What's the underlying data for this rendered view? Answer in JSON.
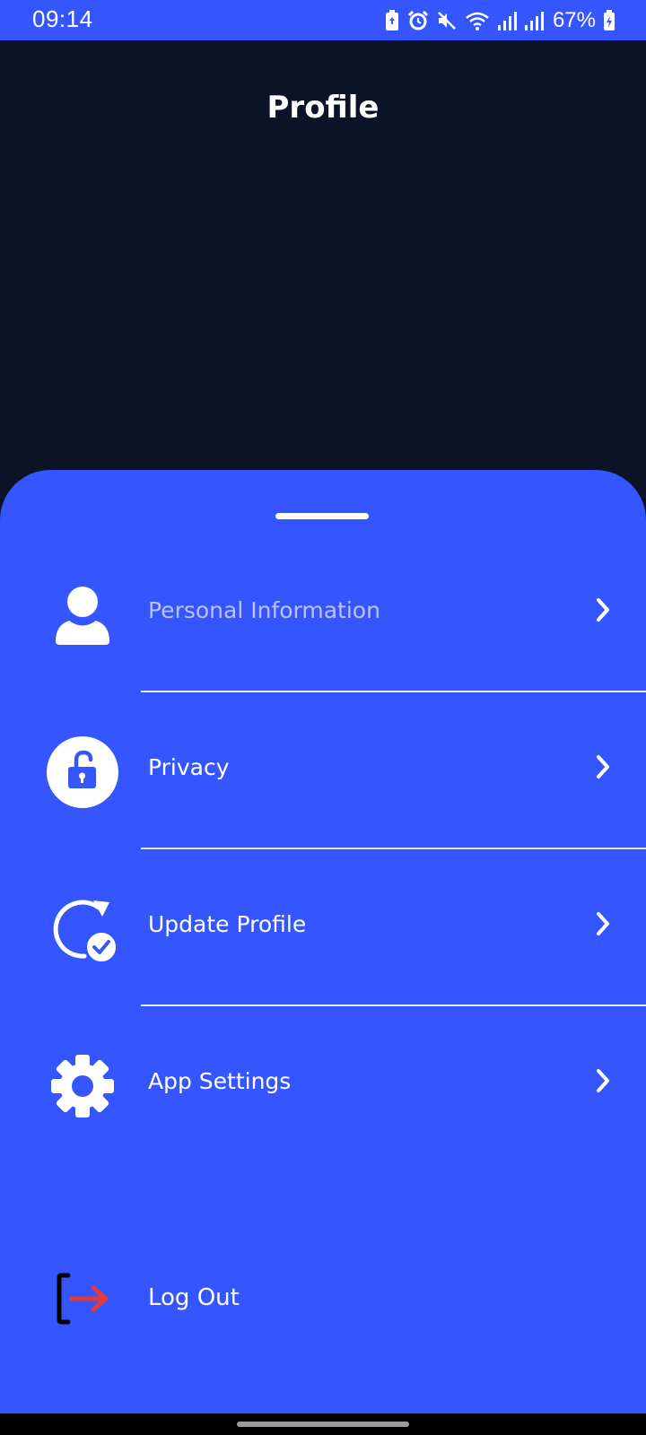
{
  "status_bar": {
    "time": "09:14",
    "battery_percent": "67%",
    "icons": [
      "battery-saver-icon",
      "alarm-icon",
      "mute-icon",
      "wifi-icon",
      "signal-icon",
      "signal-icon",
      "battery-charging-icon"
    ]
  },
  "header": {
    "title": "Profile"
  },
  "menu": [
    {
      "label": "Personal Information",
      "icon": "person-icon",
      "dimmed": true
    },
    {
      "label": "Privacy",
      "icon": "unlock-icon"
    },
    {
      "label": "Update Profile",
      "icon": "refresh-check-icon"
    },
    {
      "label": "App Settings",
      "icon": "gear-icon"
    }
  ],
  "logout": {
    "label": "Log Out",
    "icon": "logout-icon"
  },
  "colors": {
    "accent": "#3556ff",
    "background": "#0b1426",
    "logout_arrow": "#e53935"
  }
}
